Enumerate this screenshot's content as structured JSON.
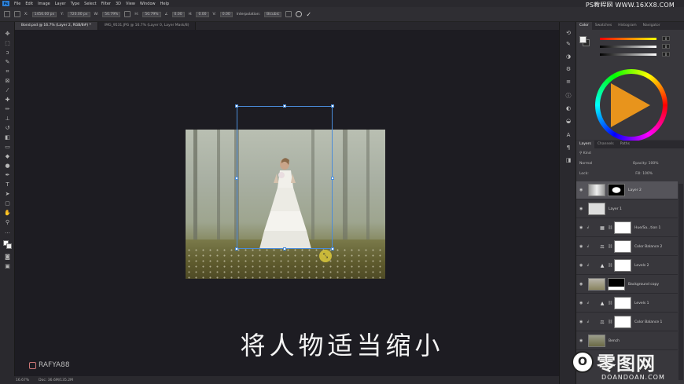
{
  "menu": {
    "app_logo": "Ps",
    "items": [
      "File",
      "Edit",
      "Image",
      "Layer",
      "Type",
      "Select",
      "Filter",
      "3D",
      "View",
      "Window",
      "Help"
    ],
    "top_watermark": "PS教程网 WWW.16XX8.COM"
  },
  "options": {
    "x": "1456.00 px",
    "y": "720.00 px",
    "w": "50.79%",
    "h": "50.79%",
    "angle": "0.00",
    "h_skew": "0.00",
    "v_skew": "0.00",
    "interpolation_label": "Interpolation:",
    "interpolation": "Bicubic"
  },
  "tabs": [
    {
      "label": "Bond.psd @ 16.7% (Layer 2, RGB/8#) *"
    },
    {
      "label": "IMG_9531.JPG @ 16.7% (Layer 0, Layer Mask/8)"
    }
  ],
  "canvas": {
    "subtitle": "将人物适当缩小",
    "instagram_handle": "RAFYA88"
  },
  "status": {
    "zoom": "16.67%",
    "doc": "Doc: 36.6M/135.2M"
  },
  "panels": {
    "color_tabs": [
      "Color",
      "Swatches",
      "Histogram",
      "Navigator"
    ],
    "slider_values": [
      "0",
      "0",
      "0"
    ],
    "layers_tabs": [
      "Layers",
      "Channels",
      "Paths"
    ],
    "kind_label": "Kind",
    "blend_mode": "Normal",
    "opacity_label": "Opacity:",
    "opacity": "100%",
    "lock_label": "Lock:",
    "fill_label": "Fill:",
    "fill": "100%",
    "layers": [
      {
        "name": "Layer 2",
        "type": "masked",
        "selected": true
      },
      {
        "name": "Layer 1",
        "type": "plain"
      },
      {
        "name": "Hue/Sa...tion 1",
        "type": "adjustment",
        "icon": "▦"
      },
      {
        "name": "Color Balance 2",
        "type": "adjustment",
        "icon": "⚖"
      },
      {
        "name": "Levels 2",
        "type": "adjustment",
        "icon": "▲"
      },
      {
        "name": "Background copy",
        "type": "masked-dark"
      },
      {
        "name": "Levels 1",
        "type": "adjustment",
        "icon": "▲"
      },
      {
        "name": "Color Balance 1",
        "type": "adjustment",
        "icon": "⚖"
      },
      {
        "name": "Bench",
        "type": "photo"
      }
    ]
  },
  "watermark": {
    "badge": "O",
    "text": "零图网",
    "sub": "DOANDOAN.COM"
  },
  "colors": {
    "accent": "#4a8bd8",
    "panel_bg": "#38373c",
    "canvas_bg": "#1d1c22"
  }
}
